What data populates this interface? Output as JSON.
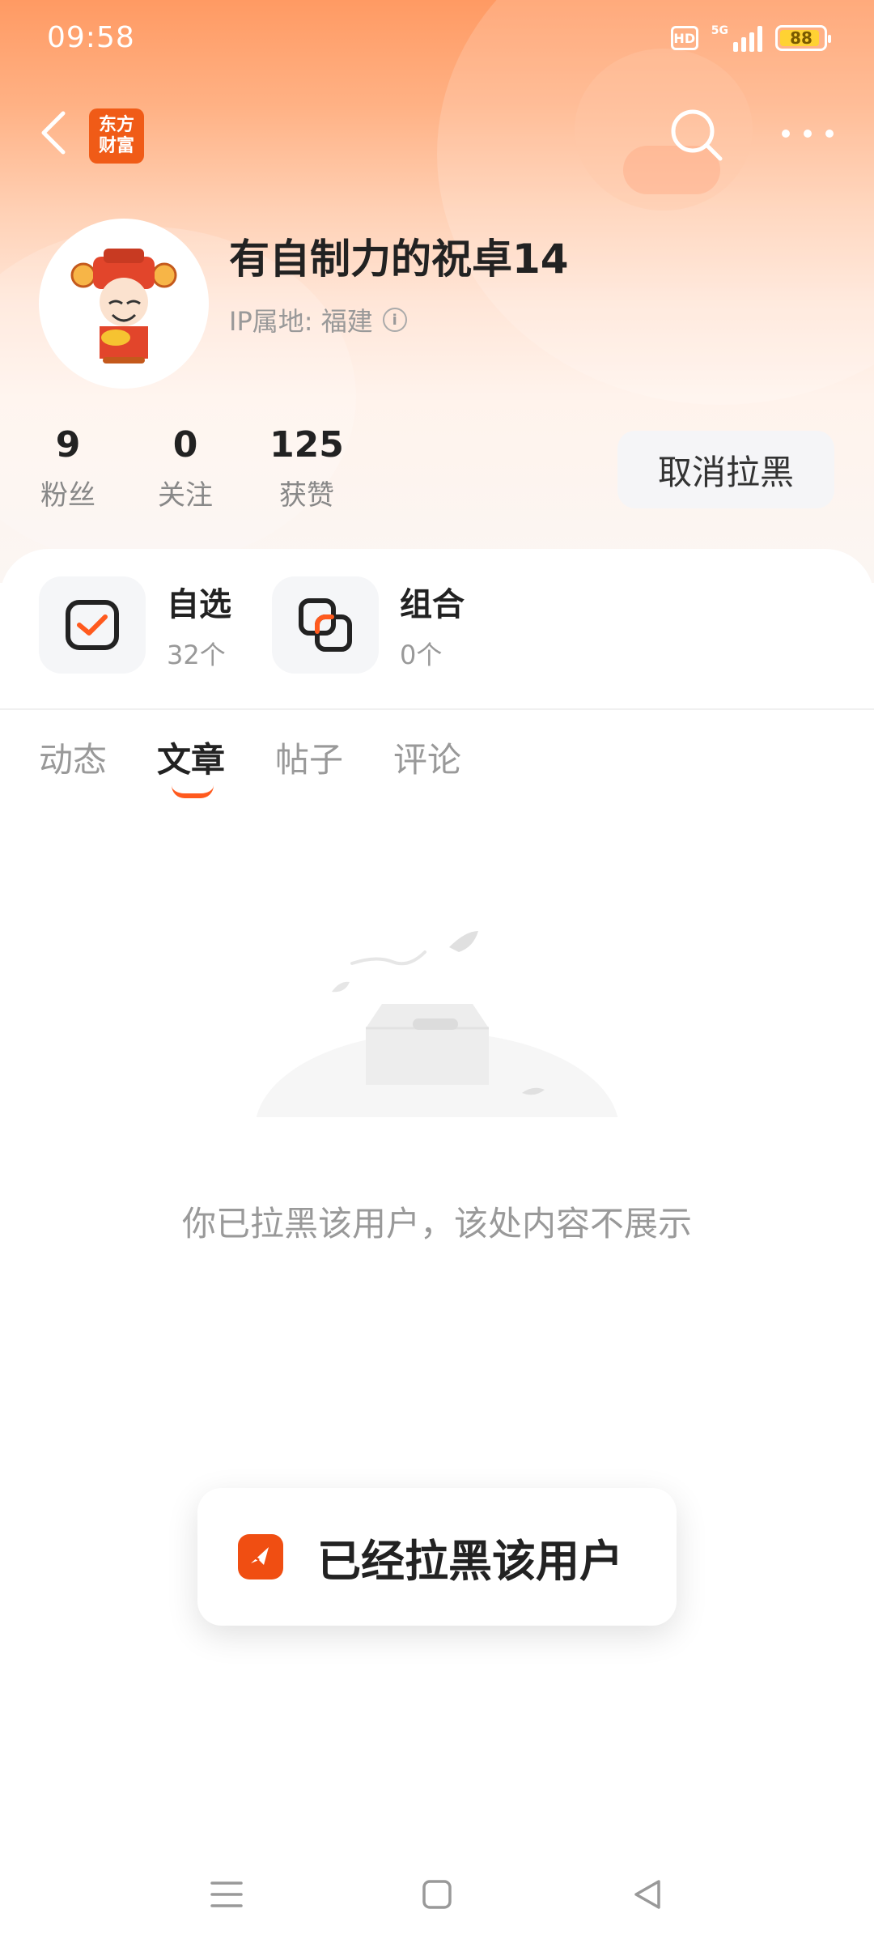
{
  "status_bar": {
    "time": "09:58",
    "hd": "HD",
    "network": "5G",
    "battery": "88"
  },
  "header": {
    "logo_text_line1": "东方",
    "logo_text_line2": "财富"
  },
  "profile": {
    "username": "有自制力的祝卓14",
    "ip_label": "IP属地: 福建",
    "stats": [
      {
        "value": "9",
        "label": "粉丝"
      },
      {
        "value": "0",
        "label": "关注"
      },
      {
        "value": "125",
        "label": "获赞"
      }
    ],
    "unblock_label": "取消拉黑"
  },
  "features": [
    {
      "title": "自选",
      "count": "32个",
      "icon": "watchlist-check-icon"
    },
    {
      "title": "组合",
      "count": "0个",
      "icon": "portfolio-icon"
    }
  ],
  "tabs": [
    "动态",
    "文章",
    "帖子",
    "评论"
  ],
  "active_tab": "文章",
  "empty_state": {
    "message": "你已拉黑该用户，该处内容不展示"
  },
  "toast": {
    "message": "已经拉黑该用户"
  },
  "colors": {
    "accent": "#ff5a1e",
    "brand": "#f05b17"
  }
}
